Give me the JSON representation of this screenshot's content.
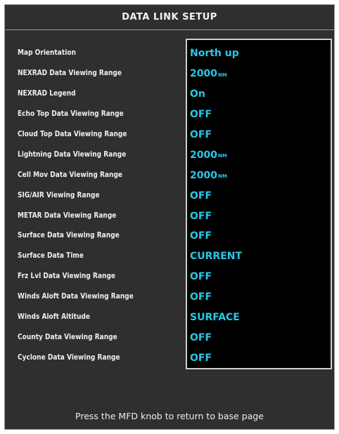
{
  "title": "DATA LINK SETUP",
  "settings": [
    {
      "label": "Map Orientation",
      "value": "North up",
      "unit": ""
    },
    {
      "label": "NEXRAD Data Viewing Range",
      "value": "2000",
      "unit": "NM"
    },
    {
      "label": "NEXRAD Legend",
      "value": "On",
      "unit": ""
    },
    {
      "label": "Echo Top Data Viewing Range",
      "value": "OFF",
      "unit": ""
    },
    {
      "label": "Cloud Top Data Viewing Range",
      "value": "OFF",
      "unit": ""
    },
    {
      "label": "Lightning Data Viewing Range",
      "value": "2000",
      "unit": "NM"
    },
    {
      "label": "Cell Mov Data Viewing Range",
      "value": "2000",
      "unit": "NM"
    },
    {
      "label": "SIG/AIR Viewing Range",
      "value": "OFF",
      "unit": ""
    },
    {
      "label": "METAR Data Viewing Range",
      "value": "OFF",
      "unit": ""
    },
    {
      "label": "Surface Data Viewing Range",
      "value": "OFF",
      "unit": ""
    },
    {
      "label": "Surface Data Time",
      "value": "CURRENT",
      "unit": ""
    },
    {
      "label": "Frz Lvl Data Viewing Range",
      "value": "OFF",
      "unit": ""
    },
    {
      "label": "Winds Aloft Data Viewing Range",
      "value": "OFF",
      "unit": ""
    },
    {
      "label": "Winds Aloft Altitude",
      "value": "SURFACE",
      "unit": ""
    },
    {
      "label": "County Data Viewing Range",
      "value": "OFF",
      "unit": ""
    },
    {
      "label": "Cyclone Data Viewing Range",
      "value": "OFF",
      "unit": ""
    }
  ],
  "footer": "Press the MFD knob to return to base page",
  "colors": {
    "background": "#2f2f2f",
    "value_text": "#27c8e8",
    "label_text": "#eeeeee",
    "value_box": "#000000",
    "border": "#cfcfcf"
  }
}
